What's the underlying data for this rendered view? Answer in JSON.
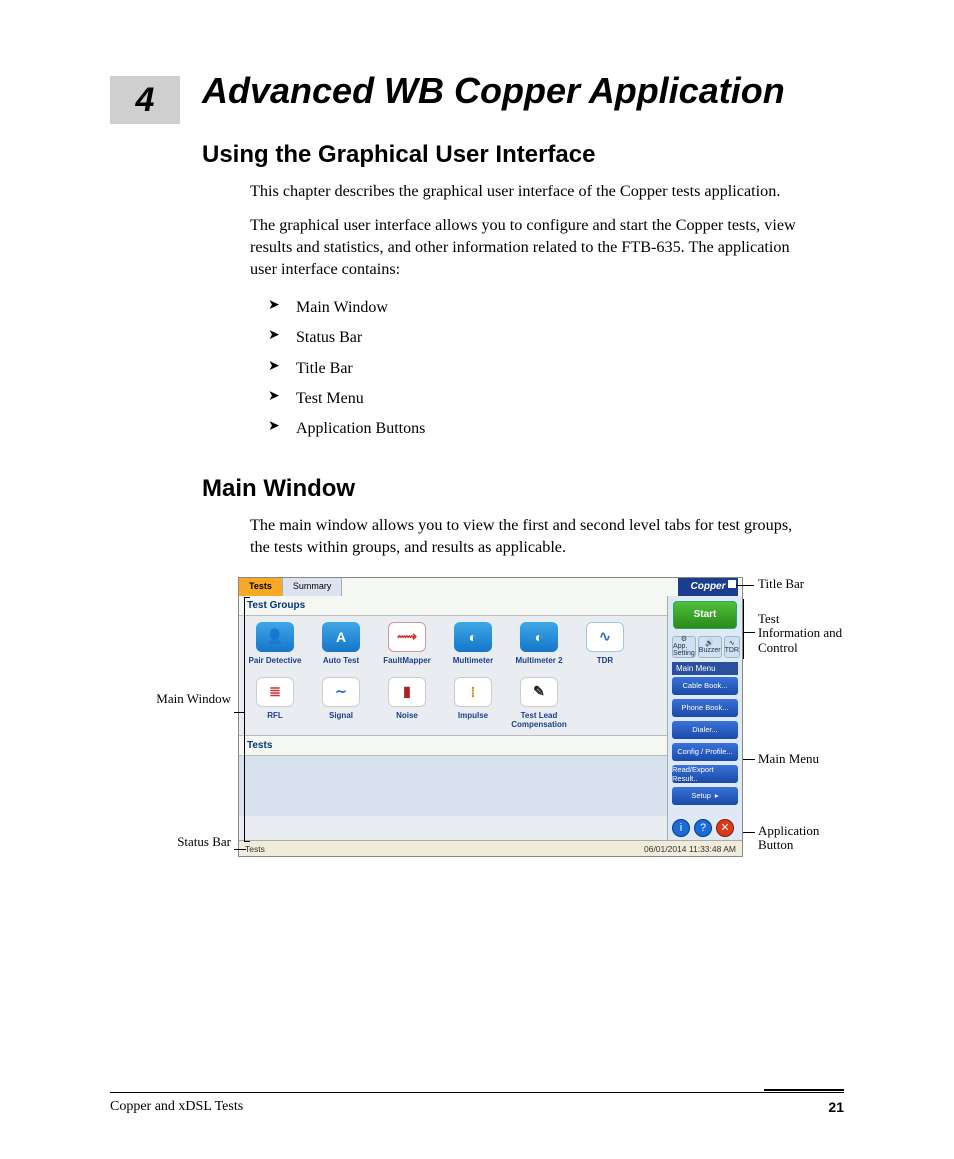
{
  "chapter": {
    "number": "4",
    "title": "Advanced WB Copper Application"
  },
  "section1": {
    "title": "Using the Graphical User Interface",
    "para1": "This chapter describes the graphical user interface of the Copper tests application.",
    "para2": "The graphical user interface allows you to configure and start the Copper tests, view results and statistics, and other information related to the FTB-635. The application user interface contains:",
    "bullets": [
      "Main Window",
      "Status Bar",
      "Title Bar",
      "Test Menu",
      "Application Buttons"
    ]
  },
  "section2": {
    "title": "Main Window",
    "para1": "The main window allows you to view the first and second level tabs for test groups, the tests within groups, and results as applicable."
  },
  "screenshot": {
    "tabs": [
      "Tests",
      "Summary"
    ],
    "title_right": "Copper",
    "panel_title": "Test Groups",
    "tests_title": "Tests",
    "row1": [
      {
        "label": "Pair Detective",
        "glyph": "👤"
      },
      {
        "label": "Auto Test",
        "glyph": "A"
      },
      {
        "label": "FaultMapper",
        "glyph": "⟿"
      },
      {
        "label": "Multimeter",
        "glyph": "◐"
      },
      {
        "label": "Multimeter 2",
        "glyph": "◐"
      },
      {
        "label": "TDR",
        "glyph": "∿"
      }
    ],
    "row2": [
      {
        "label": "RFL",
        "glyph": "≣"
      },
      {
        "label": "Signal",
        "glyph": "∼"
      },
      {
        "label": "Noise",
        "glyph": "▮"
      },
      {
        "label": "Impulse",
        "glyph": "⁞"
      },
      {
        "label": "Test Lead Compensation",
        "glyph": "✎"
      }
    ],
    "start": "Start",
    "mini": [
      {
        "label": "App. Setting"
      },
      {
        "label": "Buzzer"
      },
      {
        "label": "TDR"
      }
    ],
    "menu_head": "Main Menu",
    "menu": [
      "Cable Book...",
      "Phone Book...",
      "Dialer...",
      "Config / Profile...",
      "Read/Export Result..",
      "Setup"
    ],
    "status_left": "Tests",
    "status_right": "06/01/2014 11:33:48 AM"
  },
  "callouts": {
    "title_bar": "Title Bar",
    "test_info": "Test Information and Control",
    "main_menu": "Main Menu",
    "app_button": "Application Button",
    "main_window": "Main Window",
    "status_bar": "Status Bar"
  },
  "footer": {
    "book": "Copper and xDSL Tests",
    "page": "21"
  }
}
